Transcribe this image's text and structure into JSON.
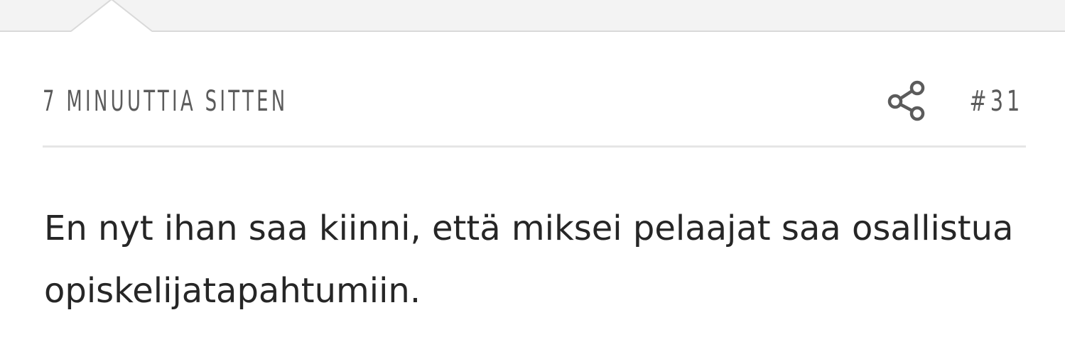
{
  "post": {
    "timestamp": "7 MINUUTTIA SITTEN",
    "number": "#31",
    "share_icon": "share-icon",
    "message": "En nyt ihan saa kiinni, että miksei pelaajat saa osallistua opiskelijatapahtumiin."
  },
  "colors": {
    "meta_text": "#5b5b5b",
    "body_text": "#262626",
    "divider": "#e6e6e6",
    "top_band": "#f3f3f3"
  }
}
